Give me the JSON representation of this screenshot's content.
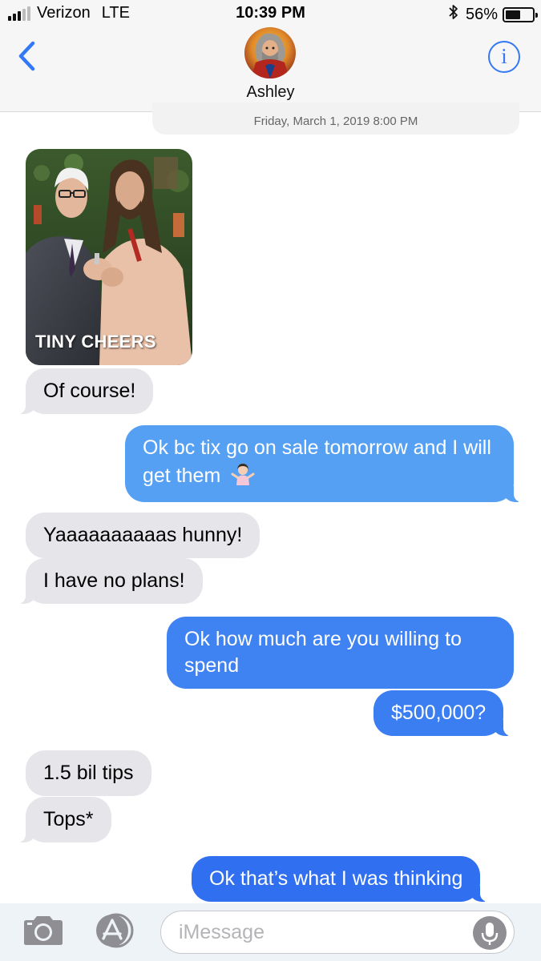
{
  "status_bar": {
    "carrier": "Verizon",
    "network": "LTE",
    "time": "10:39 PM",
    "battery": "56%",
    "battery_level": 0.56,
    "signal_bars": 3,
    "signal_max": 5
  },
  "header": {
    "contact_name": "Ashley",
    "back_icon": "chevron-left-icon",
    "info_icon": "info-icon"
  },
  "thread": {
    "timestamp": "Friday, March 1, 2019 8:00 PM",
    "gif_caption": "TINY CHEERS",
    "messages": [
      {
        "from": "them",
        "text": "Of course!"
      },
      {
        "from": "me",
        "text": "Ok bc tix go on sale tomorrow and I will get them"
      },
      {
        "from": "them",
        "text": "Yaaaaaaaaaas hunny!"
      },
      {
        "from": "them",
        "text": "I have no plans!"
      },
      {
        "from": "me",
        "text": "Ok how much are you willing to spend"
      },
      {
        "from": "me",
        "text": "$500,000?"
      },
      {
        "from": "them",
        "text": "1.5 bil tips"
      },
      {
        "from": "them",
        "text": "Tops*"
      },
      {
        "from": "me",
        "text": "Ok that’s what I was thinking"
      }
    ]
  },
  "input_bar": {
    "placeholder": "iMessage",
    "value": ""
  },
  "colors": {
    "accent": "#3478f6",
    "incoming_bubble": "#e5e5ea",
    "outgoing_top": "#5ba2f4",
    "outgoing_bottom": "#2f6ff0"
  }
}
